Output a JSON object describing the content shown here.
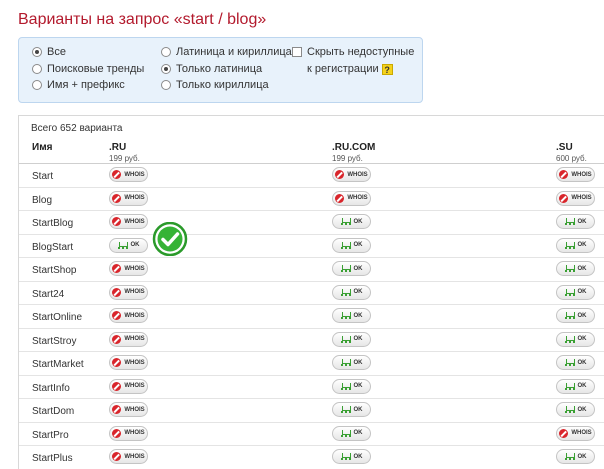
{
  "page": {
    "title": "Варианты на запрос «start / blog»"
  },
  "filters": {
    "scope_options": [
      {
        "label": "Все",
        "checked": true
      },
      {
        "label": "Поисковые тренды",
        "checked": false
      },
      {
        "label": "Имя + префикс",
        "checked": false
      }
    ],
    "script_options": [
      {
        "label": "Латиница и кириллица",
        "checked": false
      },
      {
        "label": "Только латиница",
        "checked": true
      },
      {
        "label": "Только кириллица",
        "checked": false
      }
    ],
    "hide_unavailable": {
      "label_line1": "Скрыть недоступные",
      "label_line2": "к регистрации",
      "help_label": "?",
      "checked": false
    }
  },
  "results": {
    "count_label": "Всего 652 варианта",
    "name_header": "Имя",
    "zones": [
      {
        "name": ".RU",
        "price": "199 руб."
      },
      {
        "name": ".RU.COM",
        "price": "199 руб."
      },
      {
        "name": ".SU",
        "price": "600 руб."
      }
    ],
    "whois_label": "WHOIS",
    "ok_label": "OK",
    "status_colors": {
      "taken": "#d9252b",
      "available": "#3aa033"
    },
    "rows": [
      {
        "name": "Start",
        "status": [
          "whois",
          "whois",
          "whois"
        ]
      },
      {
        "name": "Blog",
        "status": [
          "whois",
          "whois",
          "whois"
        ]
      },
      {
        "name": "StartBlog",
        "status": [
          "whois",
          "ok",
          "ok"
        ]
      },
      {
        "name": "BlogStart",
        "status": [
          "ok",
          "ok",
          "ok"
        ]
      },
      {
        "name": "StartShop",
        "status": [
          "whois",
          "ok",
          "ok"
        ]
      },
      {
        "name": "Start24",
        "status": [
          "whois",
          "ok",
          "ok"
        ]
      },
      {
        "name": "StartOnline",
        "status": [
          "whois",
          "ok",
          "ok"
        ]
      },
      {
        "name": "StartStroy",
        "status": [
          "whois",
          "ok",
          "ok"
        ]
      },
      {
        "name": "StartMarket",
        "status": [
          "whois",
          "ok",
          "ok"
        ]
      },
      {
        "name": "StartInfo",
        "status": [
          "whois",
          "ok",
          "ok"
        ]
      },
      {
        "name": "StartDom",
        "status": [
          "whois",
          "ok",
          "ok"
        ]
      },
      {
        "name": "StartPro",
        "status": [
          "whois",
          "ok",
          "whois"
        ]
      },
      {
        "name": "StartPlus",
        "status": [
          "whois",
          "ok",
          "ok"
        ]
      }
    ]
  }
}
